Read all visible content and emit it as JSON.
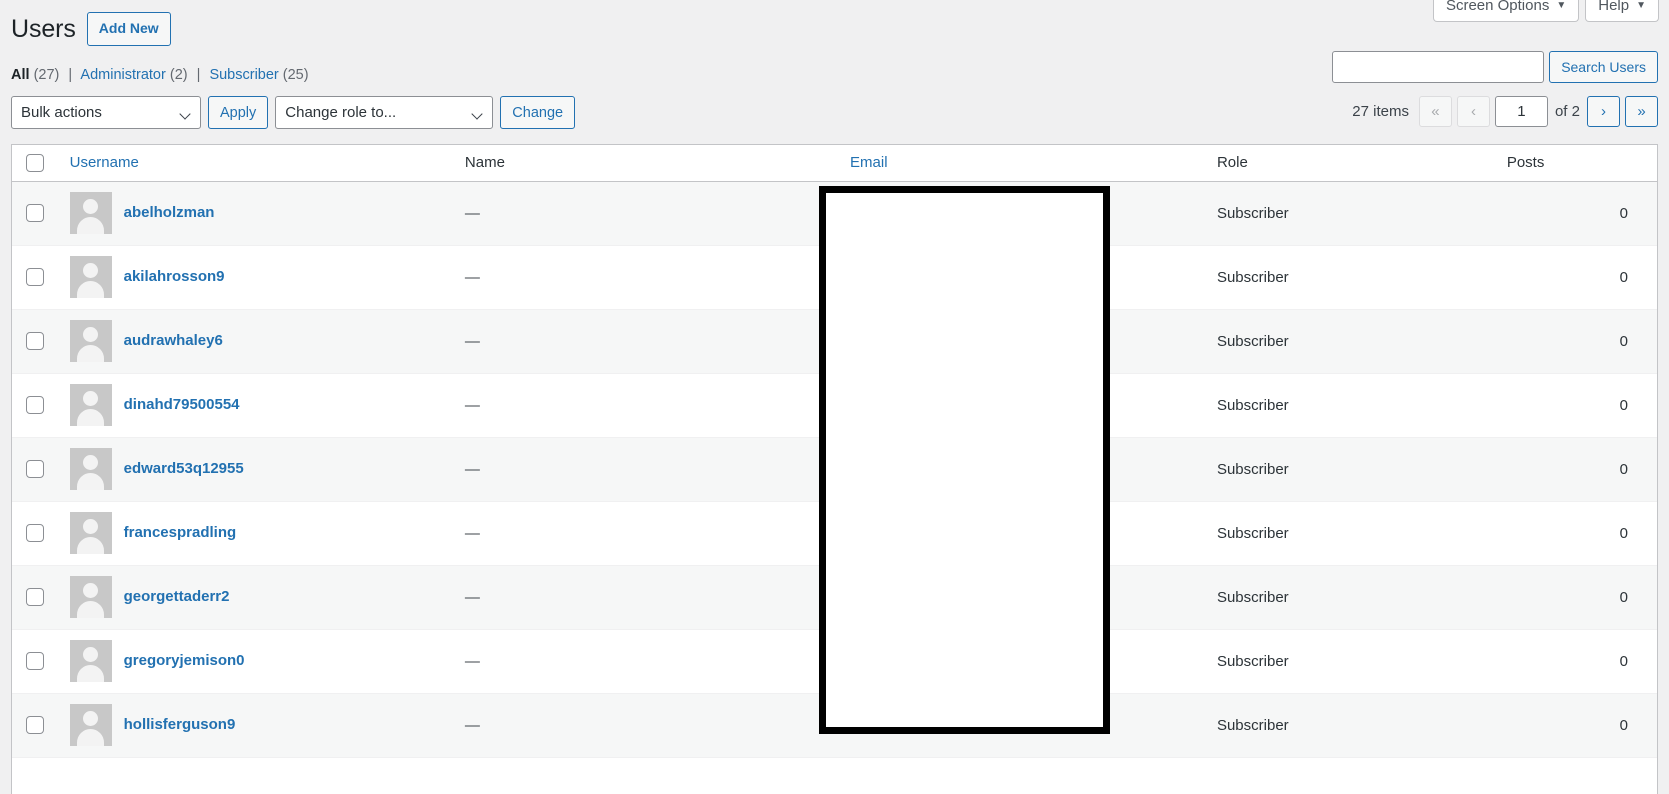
{
  "screen_meta": {
    "screen_options": "Screen Options",
    "help": "Help",
    "caret": "▼"
  },
  "header": {
    "page_title": "Users",
    "add_new_label": "Add New"
  },
  "filters": {
    "separator": "|",
    "items": [
      {
        "label": "All",
        "count": "(27)",
        "current": true
      },
      {
        "label": "Administrator",
        "count": "(2)",
        "current": false
      },
      {
        "label": "Subscriber",
        "count": "(25)",
        "current": false
      }
    ]
  },
  "search": {
    "value": "",
    "placeholder": "",
    "submit_label": "Search Users"
  },
  "toolbar": {
    "bulk_actions_selected": "Bulk actions",
    "apply_label": "Apply",
    "change_role_selected": "Change role to...",
    "change_label": "Change"
  },
  "pagination": {
    "displaying_num": "27 items",
    "first_label": "«",
    "prev_label": "‹",
    "current_page": "1",
    "total_pages_label": "of 2",
    "next_label": "›",
    "last_label": "»"
  },
  "table": {
    "columns": {
      "username": "Username",
      "name": "Name",
      "email": "Email",
      "role": "Role",
      "posts": "Posts"
    },
    "rows": [
      {
        "username": "abelholzman",
        "name": "—",
        "email": "",
        "role": "Subscriber",
        "posts": "0"
      },
      {
        "username": "akilahrosson9",
        "name": "—",
        "email": "",
        "role": "Subscriber",
        "posts": "0"
      },
      {
        "username": "audrawhaley6",
        "name": "—",
        "email": "",
        "role": "Subscriber",
        "posts": "0"
      },
      {
        "username": "dinahd79500554",
        "name": "—",
        "email": "",
        "role": "Subscriber",
        "posts": "0"
      },
      {
        "username": "edward53q12955",
        "name": "—",
        "email": "",
        "role": "Subscriber",
        "posts": "0"
      },
      {
        "username": "francespradling",
        "name": "—",
        "email": "",
        "role": "Subscriber",
        "posts": "0"
      },
      {
        "username": "georgettaderr2",
        "name": "—",
        "email": "",
        "role": "Subscriber",
        "posts": "0"
      },
      {
        "username": "gregoryjemison0",
        "name": "—",
        "email": "",
        "role": "Subscriber",
        "posts": "0"
      },
      {
        "username": "hollisferguson9",
        "name": "—",
        "email": "",
        "role": "Subscriber",
        "posts": "0"
      }
    ]
  },
  "colors": {
    "link": "#2271b1",
    "page_bg": "#f0f0f1",
    "row_alt": "#f6f7f7",
    "border": "#c3c4c7",
    "overlay": "#000000"
  }
}
